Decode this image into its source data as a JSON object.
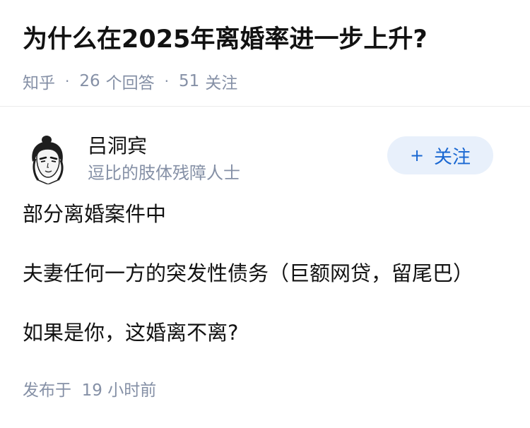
{
  "question": {
    "title": "为什么在2025年离婚率进一步上升?",
    "source": "知乎",
    "answers_count": "26",
    "answers_label": "个回答",
    "followers_count": "51",
    "followers_label": "关注"
  },
  "author": {
    "name": "吕洞宾",
    "bio": "逗比的肢体残障人士",
    "avatar_icon": "avatar-illustration-icon",
    "follow_plus": "+",
    "follow_label": "关注"
  },
  "content": {
    "paragraphs": [
      "部分离婚案件中",
      "夫妻任何一方的突发性债务（巨额网贷，留尾巴）",
      "如果是你，这婚离不离?"
    ]
  },
  "footer": {
    "published": "发布于  19 小时前"
  },
  "colors": {
    "meta": "#8590a6",
    "accent": "#1967d2",
    "follow_bg": "#e8f0fb"
  }
}
